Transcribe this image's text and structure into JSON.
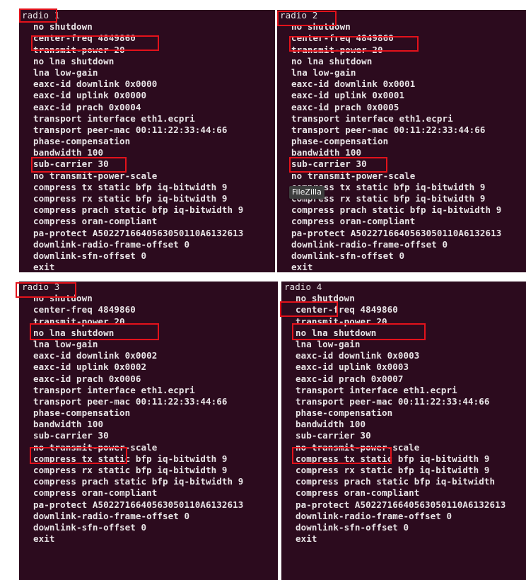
{
  "panels": [
    {
      "header": "radio 1",
      "lines": [
        "no shutdown",
        "center-freq 4849860",
        "transmit-power 20",
        "no lna shutdown",
        "lna low-gain",
        "eaxc-id downlink 0x0000",
        "eaxc-id uplink 0x0000",
        "eaxc-id prach 0x0004",
        "transport interface eth1.ecpri",
        "transport peer-mac 00:11:22:33:44:66",
        "phase-compensation",
        "bandwidth 100",
        "sub-carrier 30",
        "no transmit-power-scale",
        "compress tx static bfp iq-bitwidth 9",
        "compress rx static bfp iq-bitwidth 9",
        "compress prach static bfp iq-bitwidth 9",
        "compress oran-compliant",
        "pa-protect A5022716640563050110A6132613",
        "downlink-radio-frame-offset 0",
        "downlink-sfn-offset 0",
        "exit"
      ]
    },
    {
      "header": "radio 2",
      "lines": [
        "no shutdown",
        "center-freq 4849860",
        "transmit-power 20",
        "no lna shutdown",
        "lna low-gain",
        "eaxc-id downlink 0x0001",
        "eaxc-id uplink 0x0001",
        "eaxc-id prach 0x0005",
        "transport interface eth1.ecpri",
        "transport peer-mac 00:11:22:33:44:66",
        "phase-compensation",
        "bandwidth 100",
        "sub-carrier 30",
        "no transmit-power-scale",
        "compress tx static bfp iq-bitwidth 9",
        "compress rx static bfp iq-bitwidth 9",
        "compress prach static bfp iq-bitwidth 9",
        "compress oran-compliant",
        "pa-protect A5022716640563050110A6132613",
        "downlink-radio-frame-offset 0",
        "downlink-sfn-offset 0",
        "exit"
      ]
    },
    {
      "header": "radio 3",
      "lines": [
        "no shutdown",
        "center-freq 4849860",
        "transmit-power 20",
        "no lna shutdown",
        "lna low-gain",
        "eaxc-id downlink 0x0002",
        "eaxc-id uplink 0x0002",
        "eaxc-id prach 0x0006",
        "transport interface eth1.ecpri",
        "transport peer-mac 00:11:22:33:44:66",
        "phase-compensation",
        "bandwidth 100",
        "sub-carrier 30",
        "no transmit-power-scale",
        "compress tx static bfp iq-bitwidth 9",
        "compress rx static bfp iq-bitwidth 9",
        "compress prach static bfp iq-bitwidth 9",
        "compress oran-compliant",
        "pa-protect A5022716640563050110A6132613",
        "downlink-radio-frame-offset 0",
        "downlink-sfn-offset 0",
        "exit"
      ]
    },
    {
      "header": "radio 4",
      "lines": [
        "no shutdown",
        "center-freq 4849860",
        "transmit-power 20",
        "no lna shutdown",
        "lna low-gain",
        "eaxc-id downlink 0x0003",
        "eaxc-id uplink 0x0003",
        "eaxc-id prach 0x0007",
        "transport interface eth1.ecpri",
        "transport peer-mac 00:11:22:33:44:66",
        "phase-compensation",
        "bandwidth 100",
        "sub-carrier 30",
        "no transmit-power-scale",
        "compress tx static bfp iq-bitwidth 9",
        "compress rx static bfp iq-bitwidth 9",
        "compress prach static bfp iq-bitwidth",
        "compress oran-compliant",
        "pa-protect A5022716640563050110A6132613",
        "downlink-radio-frame-offset 0",
        "downlink-sfn-offset 0",
        "exit"
      ]
    }
  ],
  "tooltip": "FileZilla",
  "colors": {
    "terminal_bg": "#2c0b1e",
    "terminal_text": "#e8e4e6",
    "highlight": "#e3121b"
  }
}
